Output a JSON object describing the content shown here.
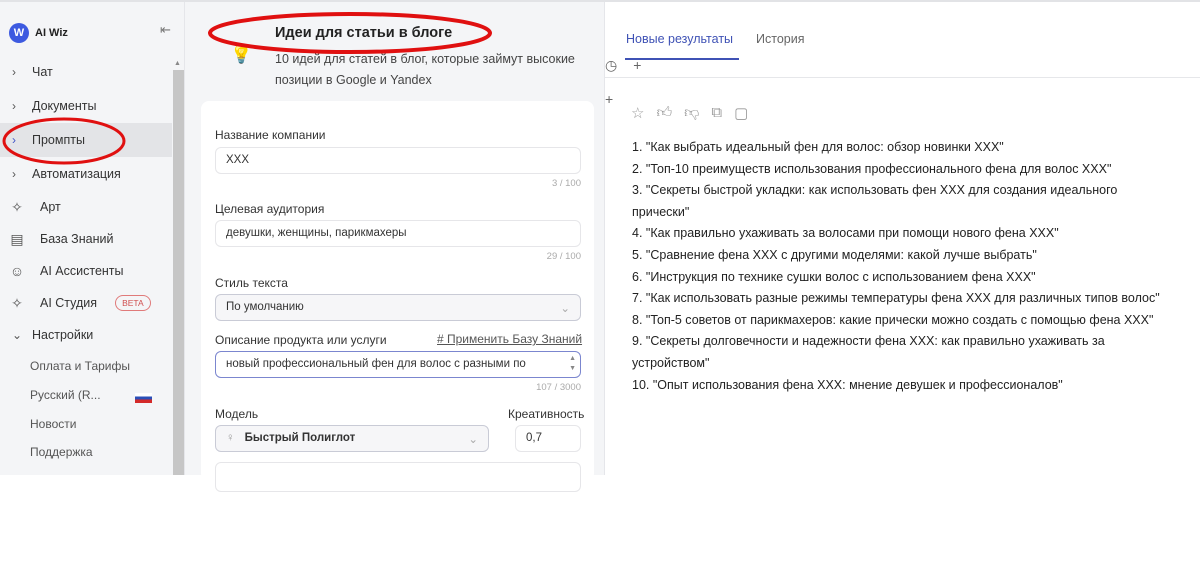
{
  "app": {
    "name": "AI Wiz",
    "logo_letter": "W"
  },
  "sidebar": {
    "items": [
      {
        "label": "Чат",
        "icon": "chevron-right-icon"
      },
      {
        "label": "Документы",
        "icon": "chevron-right-icon"
      },
      {
        "label": "Промпты",
        "icon": "chevron-right-icon"
      },
      {
        "label": "Автоматизация",
        "icon": "chevron-right-icon"
      },
      {
        "label": "Арт",
        "icon": "sparkle-icon"
      },
      {
        "label": "База Знаний",
        "icon": "book-icon"
      },
      {
        "label": "AI Ассистенты",
        "icon": "robot-icon"
      },
      {
        "label": "AI Студия",
        "icon": "sparkle-icon",
        "badge": "BETA"
      },
      {
        "label": "Настройки",
        "icon": "chevron-down-icon"
      }
    ],
    "sub_items": [
      "Оплата и Тарифы",
      "Русский (R...",
      "Новости",
      "Поддержка"
    ]
  },
  "prompt": {
    "title": "Идеи для статьи в блоге",
    "description": "10 идей для статей в блог, которые займут высокие позиции в Google и Yandex",
    "fields": {
      "company_label": "Название компании",
      "company_value": "XXX",
      "company_count": "3 / 100",
      "audience_label": "Целевая аудитория",
      "audience_value": "девушки, женщины, парикмахеры",
      "audience_count": "29 / 100",
      "style_label": "Стиль текста",
      "style_value": "По умолчанию",
      "product_label": "Описание продукта или услуги",
      "kb_link": "# Применить Базу Знаний",
      "product_value": "новый профессиональный фен для волос с разными по",
      "product_count": "107 / 3000",
      "model_label": "Модель",
      "model_value": "Быстрый Полиглот",
      "creativity_label": "Креативность",
      "creativity_value": "0,7"
    }
  },
  "results": {
    "tabs": [
      "Новые результаты",
      "История"
    ],
    "items": [
      "1. \"Как выбрать идеальный фен для волос: обзор новинки XXX\"",
      "2. \"Топ-10 преимуществ использования профессионального фена для волос XXX\"",
      "3. \"Секреты быстрой укладки: как использовать фен XXX для создания идеального прически\"",
      "4. \"Как правильно ухаживать за волосами при помощи нового фена XXX\"",
      "5. \"Сравнение фена XXX с другими моделями: какой лучше выбрать\"",
      "6. \"Инструкция по технике сушки волос с использованием фена XXX\"",
      "7. \"Как использовать разные режимы температуры фена XXX для различных типов волос\"",
      "8. \"Топ-5 советов от парикмахеров: какие прически можно создать с помощью фена XXX\"",
      "9. \"Секреты долговечности и надежности фена XXX: как правильно ухаживать за устройством\"",
      "10. \"Опыт использования фена XXX: мнение девушек и профессионалов\""
    ]
  },
  "colors": {
    "accent": "#3f52b5",
    "annotation": "#e01010"
  }
}
